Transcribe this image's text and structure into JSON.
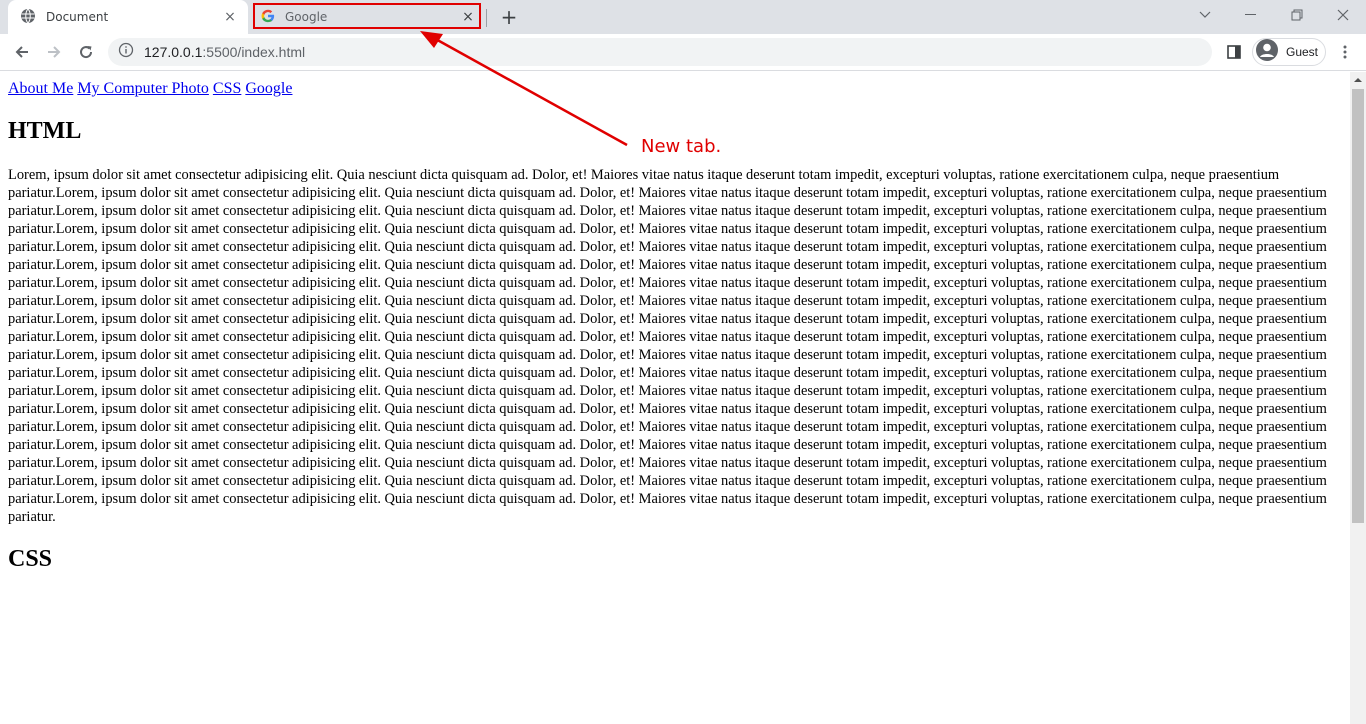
{
  "tabs": [
    {
      "title": "Document",
      "icon": "globe-icon",
      "close": "×"
    },
    {
      "title": "Google",
      "icon": "google-g-icon",
      "close": "×"
    }
  ],
  "newtab_glyph": "+",
  "window_controls": {
    "minimize": "—",
    "restore": "❐",
    "close": "✕",
    "dropdown": "⌄"
  },
  "toolbar": {
    "url_host": "127.0.0.1",
    "url_rest": ":5500/index.html",
    "profile_label": "Guest"
  },
  "page": {
    "nav_links": [
      "About Me",
      "My Computer Photo",
      "CSS",
      "Google"
    ],
    "heading": "HTML",
    "paragraph": "Lorem, ipsum dolor sit amet consectetur adipisicing elit. Quia nesciunt dicta quisquam ad. Dolor, et! Maiores vitae natus itaque deserunt totam impedit, excepturi voluptas, ratione exercitationem culpa, neque praesentium pariatur.Lorem, ipsum dolor sit amet consectetur adipisicing elit. Quia nesciunt dicta quisquam ad. Dolor, et! Maiores vitae natus itaque deserunt totam impedit, excepturi voluptas, ratione exercitationem culpa, neque praesentium pariatur.Lorem, ipsum dolor sit amet consectetur adipisicing elit. Quia nesciunt dicta quisquam ad. Dolor, et! Maiores vitae natus itaque deserunt totam impedit, excepturi voluptas, ratione exercitationem culpa, neque praesentium pariatur.Lorem, ipsum dolor sit amet consectetur adipisicing elit. Quia nesciunt dicta quisquam ad. Dolor, et! Maiores vitae natus itaque deserunt totam impedit, excepturi voluptas, ratione exercitationem culpa, neque praesentium pariatur.Lorem, ipsum dolor sit amet consectetur adipisicing elit. Quia nesciunt dicta quisquam ad. Dolor, et! Maiores vitae natus itaque deserunt totam impedit, excepturi voluptas, ratione exercitationem culpa, neque praesentium pariatur.Lorem, ipsum dolor sit amet consectetur adipisicing elit. Quia nesciunt dicta quisquam ad. Dolor, et! Maiores vitae natus itaque deserunt totam impedit, excepturi voluptas, ratione exercitationem culpa, neque praesentium pariatur.Lorem, ipsum dolor sit amet consectetur adipisicing elit. Quia nesciunt dicta quisquam ad. Dolor, et! Maiores vitae natus itaque deserunt totam impedit, excepturi voluptas, ratione exercitationem culpa, neque praesentium pariatur.Lorem, ipsum dolor sit amet consectetur adipisicing elit. Quia nesciunt dicta quisquam ad. Dolor, et! Maiores vitae natus itaque deserunt totam impedit, excepturi voluptas, ratione exercitationem culpa, neque praesentium pariatur.Lorem, ipsum dolor sit amet consectetur adipisicing elit. Quia nesciunt dicta quisquam ad. Dolor, et! Maiores vitae natus itaque deserunt totam impedit, excepturi voluptas, ratione exercitationem culpa, neque praesentium pariatur.Lorem, ipsum dolor sit amet consectetur adipisicing elit. Quia nesciunt dicta quisquam ad. Dolor, et! Maiores vitae natus itaque deserunt totam impedit, excepturi voluptas, ratione exercitationem culpa, neque praesentium pariatur.Lorem, ipsum dolor sit amet consectetur adipisicing elit. Quia nesciunt dicta quisquam ad. Dolor, et! Maiores vitae natus itaque deserunt totam impedit, excepturi voluptas, ratione exercitationem culpa, neque praesentium pariatur.Lorem, ipsum dolor sit amet consectetur adipisicing elit. Quia nesciunt dicta quisquam ad. Dolor, et! Maiores vitae natus itaque deserunt totam impedit, excepturi voluptas, ratione exercitationem culpa, neque praesentium pariatur.Lorem, ipsum dolor sit amet consectetur adipisicing elit. Quia nesciunt dicta quisquam ad. Dolor, et! Maiores vitae natus itaque deserunt totam impedit, excepturi voluptas, ratione exercitationem culpa, neque praesentium pariatur.Lorem, ipsum dolor sit amet consectetur adipisicing elit. Quia nesciunt dicta quisquam ad. Dolor, et! Maiores vitae natus itaque deserunt totam impedit, excepturi voluptas, ratione exercitationem culpa, neque praesentium pariatur.Lorem, ipsum dolor sit amet consectetur adipisicing elit. Quia nesciunt dicta quisquam ad. Dolor, et! Maiores vitae natus itaque deserunt totam impedit, excepturi voluptas, ratione exercitationem culpa, neque praesentium pariatur.Lorem, ipsum dolor sit amet consectetur adipisicing elit. Quia nesciunt dicta quisquam ad. Dolor, et! Maiores vitae natus itaque deserunt totam impedit, excepturi voluptas, ratione exercitationem culpa, neque praesentium pariatur.Lorem, ipsum dolor sit amet consectetur adipisicing elit. Quia nesciunt dicta quisquam ad. Dolor, et! Maiores vitae natus itaque deserunt totam impedit, excepturi voluptas, ratione exercitationem culpa, neque praesentium pariatur.Lorem, ipsum dolor sit amet consectetur adipisicing elit. Quia nesciunt dicta quisquam ad. Dolor, et! Maiores vitae natus itaque deserunt totam impedit, excepturi voluptas, ratione exercitationem culpa, neque praesentium pariatur.Lorem, ipsum dolor sit amet consectetur adipisicing elit. Quia nesciunt dicta quisquam ad. Dolor, et! Maiores vitae natus itaque deserunt totam impedit, excepturi voluptas, ratione exercitationem culpa, neque praesentium pariatur.",
    "heading2": "CSS"
  },
  "annotation": {
    "text": "New tab.",
    "color": "#e00000"
  },
  "colors": {
    "link": "#0000ee",
    "tabstrip": "#dee1e6",
    "omnibox": "#f1f3f4"
  }
}
